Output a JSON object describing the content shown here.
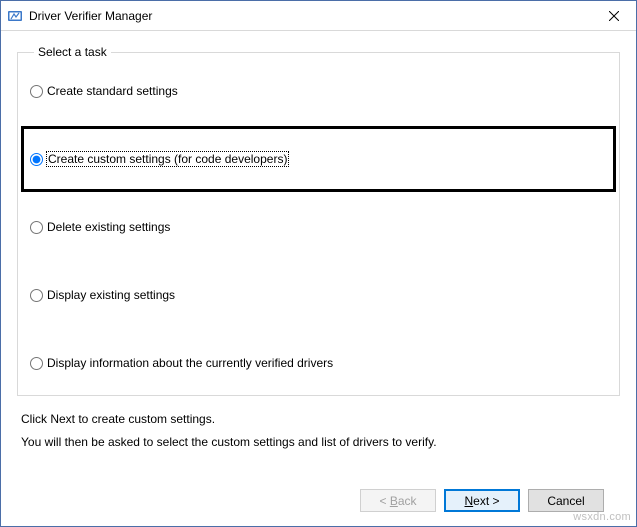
{
  "window": {
    "title": "Driver Verifier Manager"
  },
  "group": {
    "legend": "Select a task",
    "options": {
      "create_standard": "Create standard settings",
      "create_custom": "Create custom settings (for code developers)",
      "delete_existing": "Delete existing settings",
      "display_existing": "Display existing settings",
      "display_info": "Display information about the currently verified drivers"
    },
    "selected": "create_custom"
  },
  "hints": {
    "line1": "Click Next to create custom settings.",
    "line2": "You will then be asked to select the custom settings and list of drivers to verify."
  },
  "buttons": {
    "back_prefix": "< ",
    "back_mn": "B",
    "back_suffix": "ack",
    "next_mn": "N",
    "next_suffix": "ext >",
    "cancel": "Cancel"
  },
  "watermark": "wsxdn.com"
}
